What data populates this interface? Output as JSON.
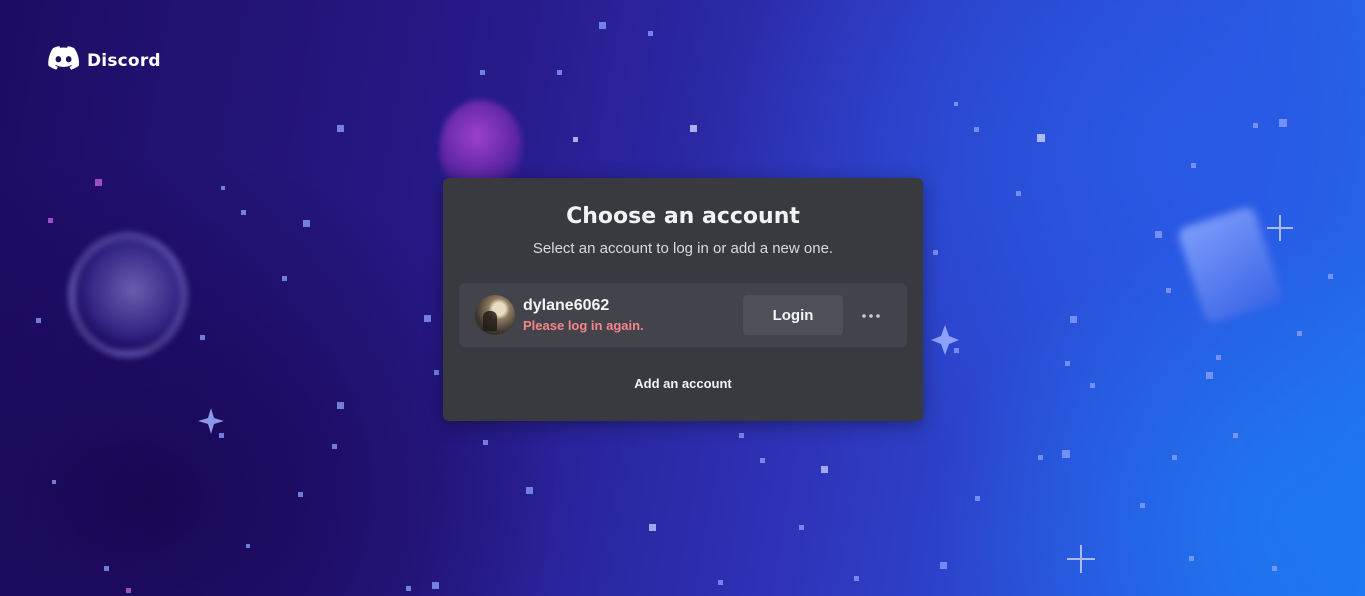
{
  "brand": {
    "name": "Discord",
    "logo_icon": "discord-clyde-icon"
  },
  "modal": {
    "title": "Choose an account",
    "subtitle": "Select an account to log in or add a new one."
  },
  "account": {
    "username": "dylane6062",
    "status": "Please log in again.",
    "status_color": "#f38688",
    "login_label": "Login",
    "more_icon": "ellipsis-icon"
  },
  "add_account_label": "Add an account",
  "colors": {
    "modal_bg": "#393a40",
    "account_row_bg": "#43444b",
    "button_bg": "#4e5058"
  }
}
